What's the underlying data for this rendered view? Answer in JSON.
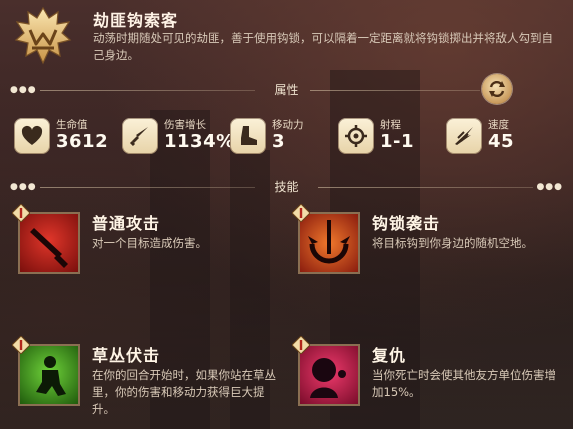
{
  "unit": {
    "name": "劫匪钩索客",
    "description": "动荡时期随处可见的劫匪，善于使用钩锁，可以隔着一定距离就将钩锁掷出并将敌人勾到自己身边。",
    "icon": "crown-claw-emblem-icon"
  },
  "sections": {
    "attributes_label": "属性",
    "skills_label": "技能"
  },
  "stats": [
    {
      "label": "生命值",
      "value": "3612",
      "icon": "heart-icon"
    },
    {
      "label": "伤害增长",
      "value": "1134%",
      "icon": "dagger-icon"
    },
    {
      "label": "移动力",
      "value": "3",
      "icon": "boot-icon"
    },
    {
      "label": "射程",
      "value": "1-1",
      "icon": "crosshair-icon"
    },
    {
      "label": "速度",
      "value": "45",
      "icon": "wing-speed-icon"
    }
  ],
  "skills": [
    {
      "name": "普通攻击",
      "description": "对一个目标造成伤害。",
      "icon": "knife-icon",
      "color": "#b3231b"
    },
    {
      "name": "钩锁袭击",
      "description": "将目标钩到你身边的随机空地。",
      "icon": "grappling-hook-icon",
      "color": "#d8481a"
    },
    {
      "name": "草丛伏击",
      "description": "在你的回合开始时，如果你站在草丛里，你的伤害和移动力获得巨大提升。",
      "icon": "crouching-figure-icon",
      "color": "#3f9a1a"
    },
    {
      "name": "复仇",
      "description": "当你死亡时会使其他友方单位伤害增加15%。",
      "icon": "revenge-head-icon",
      "color": "#c21b4a"
    }
  ],
  "colors": {
    "gold": "#e9c887",
    "badge_red": "#c0392b"
  }
}
